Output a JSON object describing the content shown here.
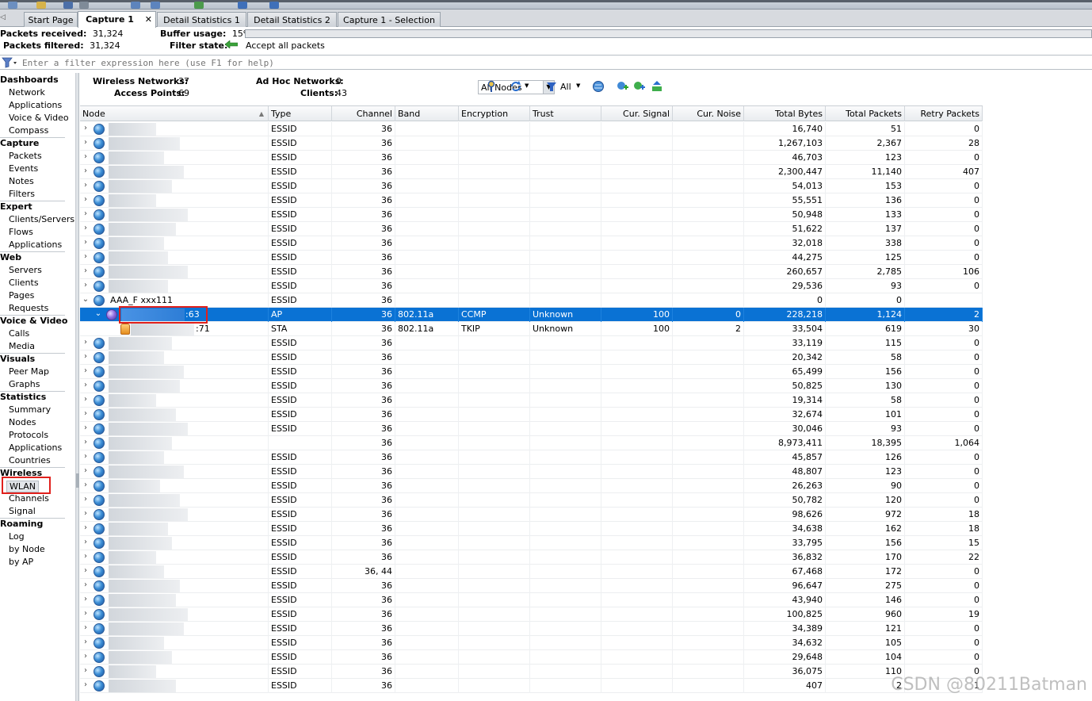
{
  "tabs": [
    {
      "label": "Start Page",
      "active": false
    },
    {
      "label": "Capture 1",
      "active": true,
      "closable": true
    },
    {
      "label": "Detail Statistics 1",
      "active": false
    },
    {
      "label": "Detail Statistics 2",
      "active": false
    },
    {
      "label": "Capture 1 - Selection",
      "active": false
    }
  ],
  "stats": {
    "packets_received_label": "Packets received:",
    "packets_received": "31,324",
    "packets_filtered_label": "Packets filtered:",
    "packets_filtered": "31,324",
    "buffer_usage_label": "Buffer usage:",
    "buffer_usage": "15%",
    "buffer_usage_fraction": 0.0,
    "filter_state_label": "Filter state:",
    "filter_state": "Accept all packets"
  },
  "filter": {
    "placeholder": "Enter a filter expression here (use F1 for help)"
  },
  "sidebar": [
    {
      "heading": "Dashboards",
      "items": [
        "Network",
        "Applications",
        "Voice & Video",
        "Compass"
      ]
    },
    {
      "heading": "Capture",
      "items": [
        "Packets",
        "Events",
        "Notes",
        "Filters"
      ]
    },
    {
      "heading": "Expert",
      "items": [
        "Clients/Servers",
        "Flows",
        "Applications"
      ]
    },
    {
      "heading": "Web",
      "items": [
        "Servers",
        "Clients",
        "Pages",
        "Requests"
      ]
    },
    {
      "heading": "Voice & Video",
      "items": [
        "Calls",
        "Media"
      ]
    },
    {
      "heading": "Visuals",
      "items": [
        "Peer Map",
        "Graphs"
      ]
    },
    {
      "heading": "Statistics",
      "items": [
        "Summary",
        "Nodes",
        "Protocols",
        "Applications",
        "Countries"
      ]
    },
    {
      "heading": "Wireless",
      "items": [
        "WLAN",
        "Channels",
        "Signal"
      ]
    },
    {
      "heading": "Roaming",
      "items": [
        "Log",
        "by Node",
        "by AP"
      ]
    }
  ],
  "summary": {
    "wireless_networks_label": "Wireless Networks:",
    "wireless_networks": "37",
    "access_points_label": "Access Points:",
    "access_points": "69",
    "adhoc_label": "Ad Hoc Networks:",
    "adhoc": "0",
    "clients_label": "Clients:",
    "clients": "43",
    "node_filter": "All Nodes",
    "all_label": "All"
  },
  "columns": [
    "Node",
    "Type",
    "Channel",
    "Band",
    "Encryption",
    "Trust",
    "Cur. Signal",
    "Cur. Noise",
    "Total Bytes",
    "Total Packets",
    "Retry Packets"
  ],
  "rows": [
    {
      "kind": "essid",
      "node": "",
      "type": "ESSID",
      "channel": "36",
      "band": "",
      "enc": "",
      "trust": "",
      "signal": "",
      "noise": "",
      "bytes": "16,740",
      "packets": "51",
      "retry": "0"
    },
    {
      "kind": "essid",
      "node": "",
      "type": "ESSID",
      "channel": "36",
      "band": "",
      "enc": "",
      "trust": "",
      "signal": "",
      "noise": "",
      "bytes": "1,267,103",
      "packets": "2,367",
      "retry": "28"
    },
    {
      "kind": "essid",
      "node": "",
      "type": "ESSID",
      "channel": "36",
      "band": "",
      "enc": "",
      "trust": "",
      "signal": "",
      "noise": "",
      "bytes": "46,703",
      "packets": "123",
      "retry": "0"
    },
    {
      "kind": "essid",
      "node": "",
      "type": "ESSID",
      "channel": "36",
      "band": "",
      "enc": "",
      "trust": "",
      "signal": "",
      "noise": "",
      "bytes": "2,300,447",
      "packets": "11,140",
      "retry": "407"
    },
    {
      "kind": "essid",
      "node": "",
      "type": "ESSID",
      "channel": "36",
      "band": "",
      "enc": "",
      "trust": "",
      "signal": "",
      "noise": "",
      "bytes": "54,013",
      "packets": "153",
      "retry": "0"
    },
    {
      "kind": "essid",
      "node": "",
      "type": "ESSID",
      "channel": "36",
      "band": "",
      "enc": "",
      "trust": "",
      "signal": "",
      "noise": "",
      "bytes": "55,551",
      "packets": "136",
      "retry": "0"
    },
    {
      "kind": "essid",
      "node": "",
      "type": "ESSID",
      "channel": "36",
      "band": "",
      "enc": "",
      "trust": "",
      "signal": "",
      "noise": "",
      "bytes": "50,948",
      "packets": "133",
      "retry": "0"
    },
    {
      "kind": "essid",
      "node": "",
      "type": "ESSID",
      "channel": "36",
      "band": "",
      "enc": "",
      "trust": "",
      "signal": "",
      "noise": "",
      "bytes": "51,622",
      "packets": "137",
      "retry": "0"
    },
    {
      "kind": "essid",
      "node": "",
      "type": "ESSID",
      "channel": "36",
      "band": "",
      "enc": "",
      "trust": "",
      "signal": "",
      "noise": "",
      "bytes": "32,018",
      "packets": "338",
      "retry": "0"
    },
    {
      "kind": "essid",
      "node": "",
      "type": "ESSID",
      "channel": "36",
      "band": "",
      "enc": "",
      "trust": "",
      "signal": "",
      "noise": "",
      "bytes": "44,275",
      "packets": "125",
      "retry": "0"
    },
    {
      "kind": "essid",
      "node": "",
      "type": "ESSID",
      "channel": "36",
      "band": "",
      "enc": "",
      "trust": "",
      "signal": "",
      "noise": "",
      "bytes": "260,657",
      "packets": "2,785",
      "retry": "106"
    },
    {
      "kind": "essid",
      "node": "",
      "type": "ESSID",
      "channel": "36",
      "band": "",
      "enc": "",
      "trust": "",
      "signal": "",
      "noise": "",
      "bytes": "29,536",
      "packets": "93",
      "retry": "0"
    },
    {
      "kind": "essid-open",
      "node": "AAA_F       xxx111",
      "type": "ESSID",
      "channel": "36",
      "band": "",
      "enc": "",
      "trust": "",
      "signal": "",
      "noise": "",
      "bytes": "0",
      "packets": "0",
      "retry": ""
    },
    {
      "kind": "ap",
      "node": ":63",
      "type": "AP",
      "channel": "36",
      "band": "802.11a",
      "enc": "CCMP",
      "trust": "Unknown",
      "signal": "100",
      "noise": "0",
      "bytes": "228,218",
      "packets": "1,124",
      "retry": "2"
    },
    {
      "kind": "sta",
      "node": ":71",
      "type": "STA",
      "channel": "36",
      "band": "802.11a",
      "enc": "TKIP",
      "trust": "Unknown",
      "signal": "100",
      "noise": "2",
      "bytes": "33,504",
      "packets": "619",
      "retry": "30"
    },
    {
      "kind": "essid",
      "node": "",
      "type": "ESSID",
      "channel": "36",
      "band": "",
      "enc": "",
      "trust": "",
      "signal": "",
      "noise": "",
      "bytes": "33,119",
      "packets": "115",
      "retry": "0"
    },
    {
      "kind": "essid",
      "node": "",
      "type": "ESSID",
      "channel": "36",
      "band": "",
      "enc": "",
      "trust": "",
      "signal": "",
      "noise": "",
      "bytes": "20,342",
      "packets": "58",
      "retry": "0"
    },
    {
      "kind": "essid",
      "node": "",
      "type": "ESSID",
      "channel": "36",
      "band": "",
      "enc": "",
      "trust": "",
      "signal": "",
      "noise": "",
      "bytes": "65,499",
      "packets": "156",
      "retry": "0"
    },
    {
      "kind": "essid",
      "node": "",
      "type": "ESSID",
      "channel": "36",
      "band": "",
      "enc": "",
      "trust": "",
      "signal": "",
      "noise": "",
      "bytes": "50,825",
      "packets": "130",
      "retry": "0"
    },
    {
      "kind": "essid",
      "node": "",
      "type": "ESSID",
      "channel": "36",
      "band": "",
      "enc": "",
      "trust": "",
      "signal": "",
      "noise": "",
      "bytes": "19,314",
      "packets": "58",
      "retry": "0"
    },
    {
      "kind": "essid",
      "node": "",
      "type": "ESSID",
      "channel": "36",
      "band": "",
      "enc": "",
      "trust": "",
      "signal": "",
      "noise": "",
      "bytes": "32,674",
      "packets": "101",
      "retry": "0"
    },
    {
      "kind": "essid",
      "node": "",
      "type": "ESSID",
      "channel": "36",
      "band": "",
      "enc": "",
      "trust": "",
      "signal": "",
      "noise": "",
      "bytes": "30,046",
      "packets": "93",
      "retry": "0"
    },
    {
      "kind": "essid",
      "node": "",
      "type": "",
      "channel": "36",
      "band": "",
      "enc": "",
      "trust": "",
      "signal": "",
      "noise": "",
      "bytes": "8,973,411",
      "packets": "18,395",
      "retry": "1,064"
    },
    {
      "kind": "essid",
      "node": "",
      "type": "ESSID",
      "channel": "36",
      "band": "",
      "enc": "",
      "trust": "",
      "signal": "",
      "noise": "",
      "bytes": "45,857",
      "packets": "126",
      "retry": "0"
    },
    {
      "kind": "essid",
      "node": "",
      "type": "ESSID",
      "channel": "36",
      "band": "",
      "enc": "",
      "trust": "",
      "signal": "",
      "noise": "",
      "bytes": "48,807",
      "packets": "123",
      "retry": "0"
    },
    {
      "kind": "essid",
      "node": "",
      "type": "ESSID",
      "channel": "36",
      "band": "",
      "enc": "",
      "trust": "",
      "signal": "",
      "noise": "",
      "bytes": "26,263",
      "packets": "90",
      "retry": "0"
    },
    {
      "kind": "essid",
      "node": "",
      "type": "ESSID",
      "channel": "36",
      "band": "",
      "enc": "",
      "trust": "",
      "signal": "",
      "noise": "",
      "bytes": "50,782",
      "packets": "120",
      "retry": "0"
    },
    {
      "kind": "essid",
      "node": "",
      "type": "ESSID",
      "channel": "36",
      "band": "",
      "enc": "",
      "trust": "",
      "signal": "",
      "noise": "",
      "bytes": "98,626",
      "packets": "972",
      "retry": "18"
    },
    {
      "kind": "essid",
      "node": "",
      "type": "ESSID",
      "channel": "36",
      "band": "",
      "enc": "",
      "trust": "",
      "signal": "",
      "noise": "",
      "bytes": "34,638",
      "packets": "162",
      "retry": "18"
    },
    {
      "kind": "essid",
      "node": "",
      "type": "ESSID",
      "channel": "36",
      "band": "",
      "enc": "",
      "trust": "",
      "signal": "",
      "noise": "",
      "bytes": "33,795",
      "packets": "156",
      "retry": "15"
    },
    {
      "kind": "essid",
      "node": "",
      "type": "ESSID",
      "channel": "36",
      "band": "",
      "enc": "",
      "trust": "",
      "signal": "",
      "noise": "",
      "bytes": "36,832",
      "packets": "170",
      "retry": "22"
    },
    {
      "kind": "essid",
      "node": "",
      "type": "ESSID",
      "channel": "36, 44",
      "band": "",
      "enc": "",
      "trust": "",
      "signal": "",
      "noise": "",
      "bytes": "67,468",
      "packets": "172",
      "retry": "0"
    },
    {
      "kind": "essid",
      "node": "",
      "type": "ESSID",
      "channel": "36",
      "band": "",
      "enc": "",
      "trust": "",
      "signal": "",
      "noise": "",
      "bytes": "96,647",
      "packets": "275",
      "retry": "0"
    },
    {
      "kind": "essid",
      "node": "",
      "type": "ESSID",
      "channel": "36",
      "band": "",
      "enc": "",
      "trust": "",
      "signal": "",
      "noise": "",
      "bytes": "43,940",
      "packets": "146",
      "retry": "0"
    },
    {
      "kind": "essid",
      "node": "",
      "type": "ESSID",
      "channel": "36",
      "band": "",
      "enc": "",
      "trust": "",
      "signal": "",
      "noise": "",
      "bytes": "100,825",
      "packets": "960",
      "retry": "19"
    },
    {
      "kind": "essid",
      "node": "",
      "type": "ESSID",
      "channel": "36",
      "band": "",
      "enc": "",
      "trust": "",
      "signal": "",
      "noise": "",
      "bytes": "34,389",
      "packets": "121",
      "retry": "0"
    },
    {
      "kind": "essid",
      "node": "",
      "type": "ESSID",
      "channel": "36",
      "band": "",
      "enc": "",
      "trust": "",
      "signal": "",
      "noise": "",
      "bytes": "34,632",
      "packets": "105",
      "retry": "0"
    },
    {
      "kind": "essid",
      "node": "",
      "type": "ESSID",
      "channel": "36",
      "band": "",
      "enc": "",
      "trust": "",
      "signal": "",
      "noise": "",
      "bytes": "29,648",
      "packets": "104",
      "retry": "0"
    },
    {
      "kind": "essid",
      "node": "",
      "type": "ESSID",
      "channel": "36",
      "band": "",
      "enc": "",
      "trust": "",
      "signal": "",
      "noise": "",
      "bytes": "36,075",
      "packets": "110",
      "retry": "0"
    },
    {
      "kind": "essid",
      "node": "",
      "type": "ESSID",
      "channel": "36",
      "band": "",
      "enc": "",
      "trust": "",
      "signal": "",
      "noise": "",
      "bytes": "407",
      "packets": "2",
      "retry": "1"
    }
  ],
  "watermark": "CSDN @80211Batman",
  "colors": {
    "selection": "#0a72d4",
    "highlight_box": "#e0201c"
  }
}
